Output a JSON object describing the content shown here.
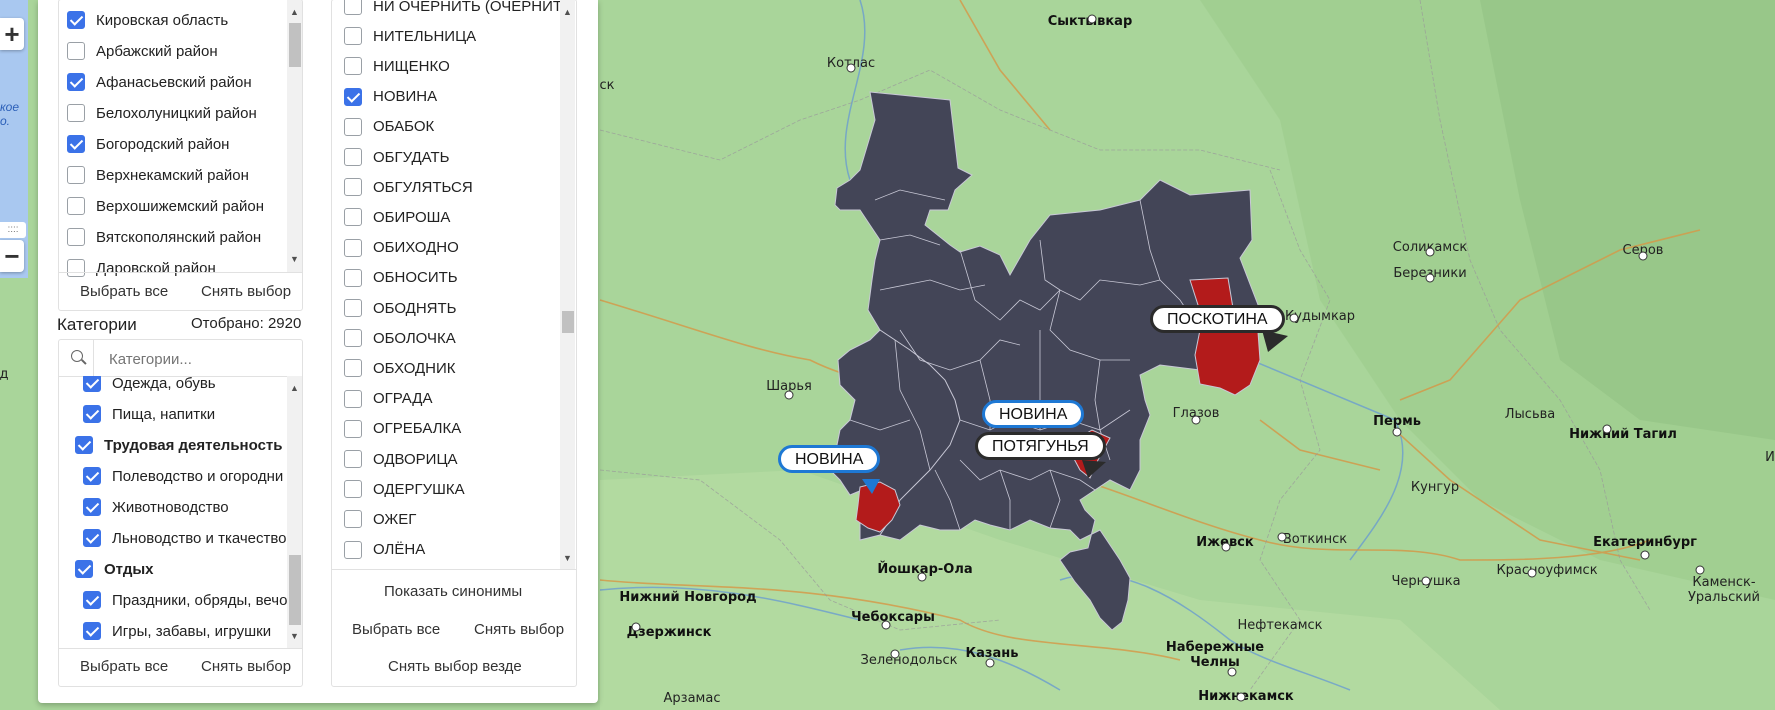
{
  "colors": {
    "region_fill": "#434557",
    "highlight": "#b31b1b",
    "map_bg": "#a9d59a",
    "checkbox_accent": "#3b72e8",
    "callout_blue": "#1e78d4"
  },
  "regions_list": {
    "items": [
      {
        "label": "Кировская область",
        "checked": true
      },
      {
        "label": "Арбажский район",
        "checked": false
      },
      {
        "label": "Афанасьевский район",
        "checked": true
      },
      {
        "label": "Белохолуницкий район",
        "checked": false
      },
      {
        "label": "Богородский район",
        "checked": true
      },
      {
        "label": "Верхнекамский район",
        "checked": false
      },
      {
        "label": "Верхошижемский район",
        "checked": false
      },
      {
        "label": "Вятскополянский район",
        "checked": false
      },
      {
        "label": "Даровской район",
        "checked": false
      }
    ],
    "select_all": "Выбрать все",
    "deselect": "Снять выбор"
  },
  "categories": {
    "title": "Категории",
    "count": "Отобрано: 2920",
    "search_placeholder": "Категории...",
    "items": [
      {
        "label": "Одежда, обувь",
        "checked": true,
        "bold": false,
        "indent": 1
      },
      {
        "label": "Пища, напитки",
        "checked": true,
        "bold": false,
        "indent": 1
      },
      {
        "label": "Трудовая деятельность",
        "checked": true,
        "bold": true,
        "indent": 0
      },
      {
        "label": "Полеводство и огородни",
        "checked": true,
        "bold": false,
        "indent": 1
      },
      {
        "label": "Животноводство",
        "checked": true,
        "bold": false,
        "indent": 1
      },
      {
        "label": "Льноводство и ткачество",
        "checked": true,
        "bold": false,
        "indent": 1
      },
      {
        "label": "Отдых",
        "checked": true,
        "bold": true,
        "indent": 0
      },
      {
        "label": "Праздники, обряды, вечо",
        "checked": true,
        "bold": false,
        "indent": 1
      },
      {
        "label": "Игры, забавы, игрушки",
        "checked": true,
        "bold": false,
        "indent": 1
      }
    ],
    "select_all": "Выбрать все",
    "deselect": "Снять выбор"
  },
  "words": {
    "items": [
      {
        "label": "НИ ОЧЕРНИТЬ (ОЧЕРНИТЬ)",
        "checked": false
      },
      {
        "label": "НИТЕЛЬНИЦА",
        "checked": false
      },
      {
        "label": "НИЩЕНКО",
        "checked": false
      },
      {
        "label": "НОВИНА",
        "checked": true
      },
      {
        "label": "ОБАБОК",
        "checked": false
      },
      {
        "label": "ОБГУДАТЬ",
        "checked": false
      },
      {
        "label": "ОБГУЛЯТЬСЯ",
        "checked": false
      },
      {
        "label": "ОБИРОША",
        "checked": false
      },
      {
        "label": "ОБИХОДНО",
        "checked": false
      },
      {
        "label": "ОБНОСИТЬ",
        "checked": false
      },
      {
        "label": "ОБОДНЯТЬ",
        "checked": false
      },
      {
        "label": "ОБОЛОЧКА",
        "checked": false
      },
      {
        "label": "ОБХОДНИК",
        "checked": false
      },
      {
        "label": "ОГРАДА",
        "checked": false
      },
      {
        "label": "ОГРЕБАЛКА",
        "checked": false
      },
      {
        "label": "ОДВОРИЦА",
        "checked": false
      },
      {
        "label": "ОДЕРГУШКА",
        "checked": false
      },
      {
        "label": "ОЖЕГ",
        "checked": false
      },
      {
        "label": "ОЛЁНА",
        "checked": false
      }
    ],
    "show_synonyms": "Показать синонимы",
    "select_all": "Выбрать все",
    "deselect": "Снять выбор",
    "deselect_everywhere": "Снять выбор везде"
  },
  "zoom": {
    "plus": "+",
    "minus": "−",
    "lake_text": "кое\nо."
  },
  "callouts": [
    {
      "label": "ПОСКОТИНА",
      "style": "dark"
    },
    {
      "label": "НОВИНА",
      "style": "blue"
    },
    {
      "label": "ПОТЯГУНЬЯ",
      "style": "dark"
    },
    {
      "label": "НОВИНА",
      "style": "blue"
    }
  ],
  "cities": [
    {
      "name": "Сыктывкар",
      "bold": true
    },
    {
      "name": "Котлас",
      "bold": false
    },
    {
      "name": "ск",
      "bold": false
    },
    {
      "name": "Соликамск",
      "bold": false
    },
    {
      "name": "Березники",
      "bold": false
    },
    {
      "name": "Серов",
      "bold": false
    },
    {
      "name": "Кудымкар",
      "bold": false
    },
    {
      "name": "Шарья",
      "bold": false
    },
    {
      "name": "Глазов",
      "bold": false
    },
    {
      "name": "Пермь",
      "bold": true
    },
    {
      "name": "Лысьва",
      "bold": false
    },
    {
      "name": "Нижний Тагил",
      "bold": true
    },
    {
      "name": "И",
      "bold": false
    },
    {
      "name": "Кунгур",
      "bold": false
    },
    {
      "name": "Ижевск",
      "bold": true
    },
    {
      "name": "Воткинск",
      "bold": false
    },
    {
      "name": "Екатеринбург",
      "bold": true
    },
    {
      "name": "Йошкар-Ола",
      "bold": true
    },
    {
      "name": "Нижний Новгород",
      "bold": true
    },
    {
      "name": "Чебоксары",
      "bold": true
    },
    {
      "name": "Дзержинск",
      "bold": true
    },
    {
      "name": "Чернушка",
      "bold": false
    },
    {
      "name": "Красноуфимск",
      "bold": false
    },
    {
      "name": "Каменск-\nУральский",
      "bold": false
    },
    {
      "name": "Нефтекамск",
      "bold": false
    },
    {
      "name": "Набережные\nЧелны",
      "bold": true
    },
    {
      "name": "Зеленодольск",
      "bold": false
    },
    {
      "name": "Казань",
      "bold": true
    },
    {
      "name": "Нижнекамск",
      "bold": true
    },
    {
      "name": "Арзамас",
      "bold": false
    },
    {
      "name": "д",
      "bold": false
    }
  ]
}
